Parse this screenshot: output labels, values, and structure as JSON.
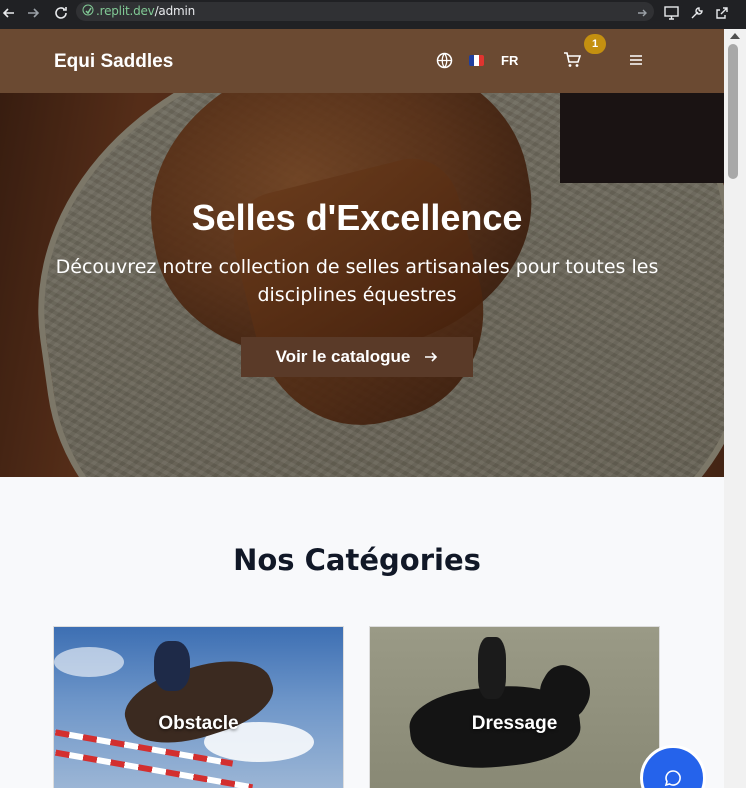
{
  "browser": {
    "url_host": ".replit.dev",
    "url_path": "/admin",
    "back_icon": "arrow-left-icon",
    "forward_icon": "arrow-right-icon",
    "reload_icon": "reload-icon"
  },
  "header": {
    "brand": "Equi Saddles",
    "language_code": "FR",
    "cart_count": "1",
    "colors": {
      "background": "#6b4a32",
      "badge": "#c49010"
    }
  },
  "hero": {
    "title": "Selles d'Excellence",
    "subtitle": "Découvrez notre collection de selles artisanales pour toutes les disciplines équestres",
    "cta_label": "Voir le catalogue",
    "colors": {
      "cta": "#5a3a28"
    }
  },
  "categories": {
    "title": "Nos Catégories",
    "items": [
      {
        "label": "Obstacle"
      },
      {
        "label": "Dressage"
      }
    ]
  },
  "chat": {
    "icon": "chat-bubble-icon",
    "color": "#2563eb"
  }
}
